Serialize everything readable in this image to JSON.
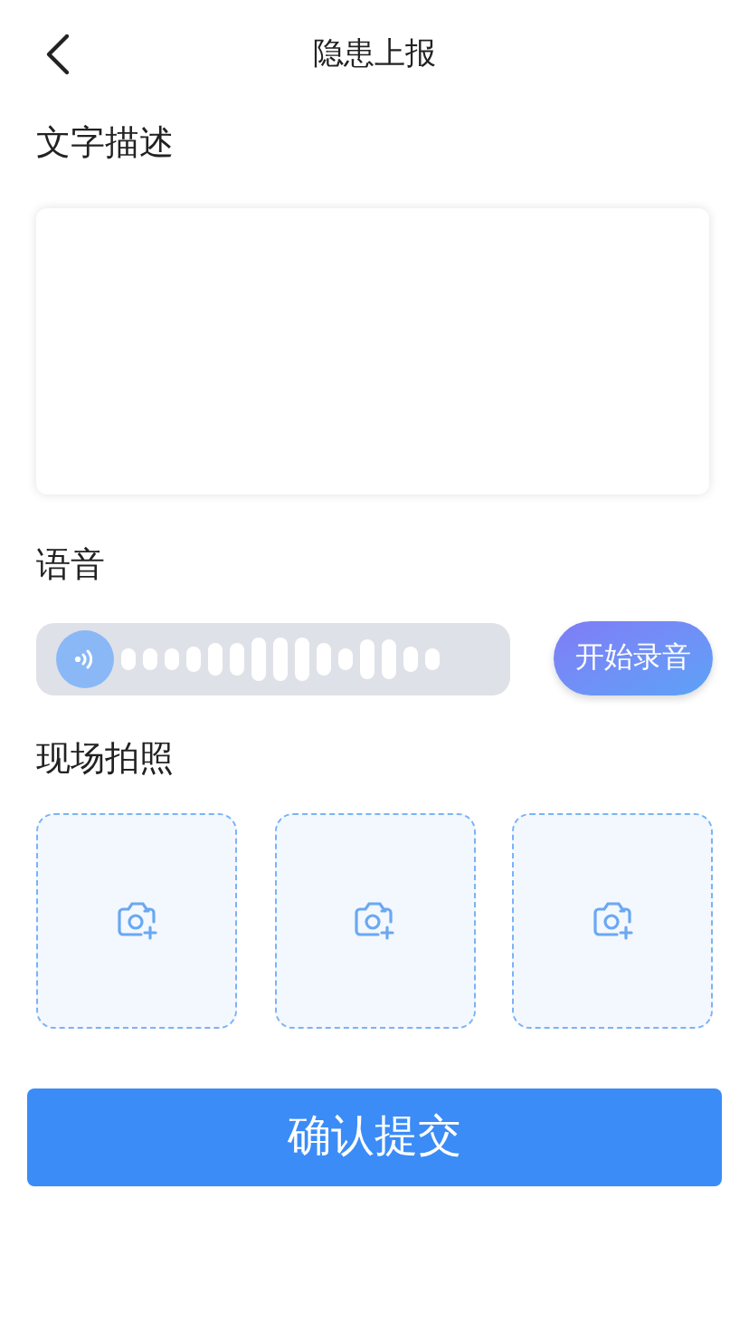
{
  "header": {
    "title": "隐患上报"
  },
  "description": {
    "label": "文字描述"
  },
  "voice": {
    "label": "语音",
    "record_button": "开始录音"
  },
  "photos": {
    "label": "现场拍照",
    "slots": [
      {
        "kind": "add"
      },
      {
        "kind": "add"
      },
      {
        "kind": "add"
      }
    ]
  },
  "submit_button": "确认提交"
}
